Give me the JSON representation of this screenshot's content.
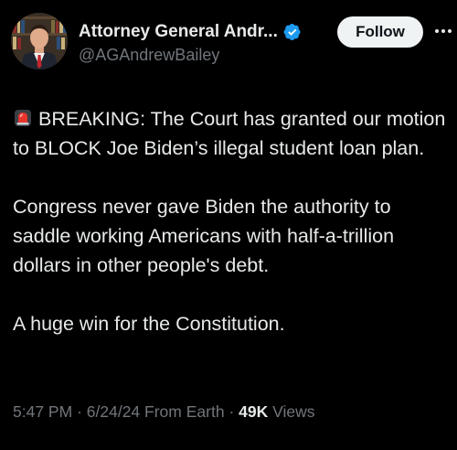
{
  "author": {
    "display_name": "Attorney General Andr...",
    "handle": "@AGAndrewBailey",
    "verified_icon": "verified-badge-icon",
    "verified_color": "#1d9bf0"
  },
  "actions": {
    "follow_label": "Follow",
    "more_icon": "more-icon"
  },
  "tweet": {
    "lines": [
      "BREAKING: The Court has granted our motion to BLOCK Joe Biden’s illegal student loan plan.",
      "Congress never gave Biden the authority to saddle working Americans with half-a-trillion dollars in other people's debt.",
      "A huge win for the Constitution."
    ],
    "leading_emoji": "siren-icon"
  },
  "meta": {
    "time": "5:47 PM",
    "separator": "·",
    "date": "6/24/24",
    "source": "From Earth",
    "views_count": "49K",
    "views_label": "Views"
  },
  "colors": {
    "background": "#000000",
    "text": "#e7e9ea",
    "secondary": "#71767b",
    "follow_bg": "#eff3f4"
  }
}
